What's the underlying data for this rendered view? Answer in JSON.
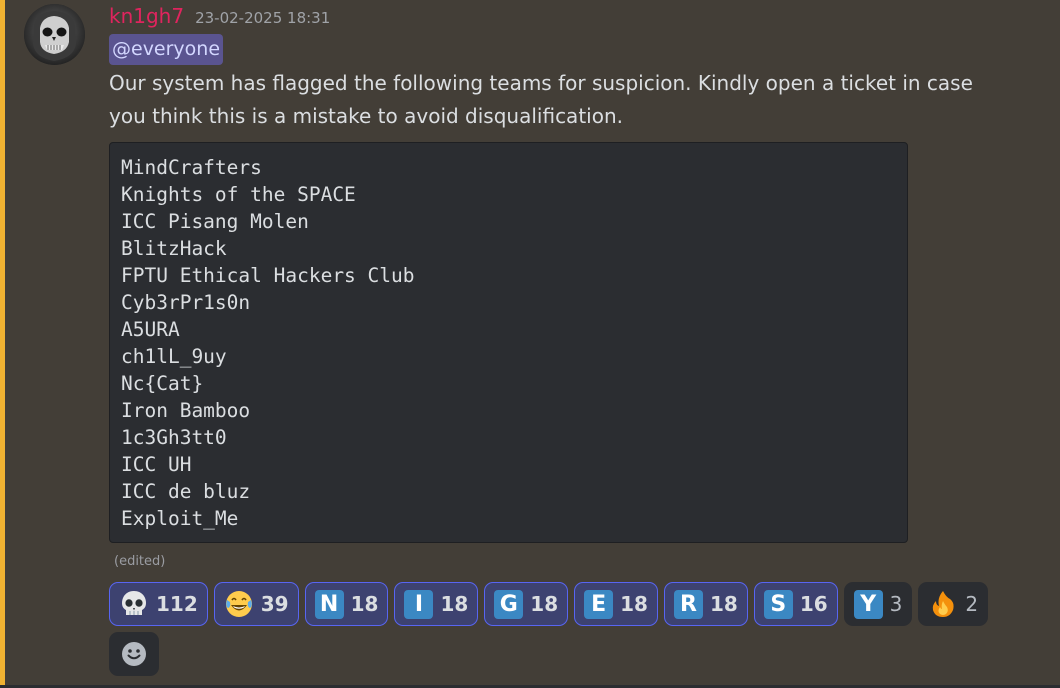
{
  "message": {
    "username": "kn1gh7",
    "timestamp": "23-02-2025 18:31",
    "mention": "@everyone",
    "text": "Our system has flagged the following teams for suspicion. Kindly open a ticket in case you think this is a mistake to avoid disqualification.",
    "code_lines": [
      "MindCrafters",
      "Knights of the SPACE",
      "ICC Pisang Molen",
      "BlitzHack",
      "FPTU Ethical Hackers Club",
      "Cyb3rPr1s0n",
      "A5URA",
      "ch1lL_9uy",
      "Nc{Cat}",
      "Iron Bamboo",
      "1c3Gh3tt0",
      "ICC UH",
      "ICC de bluz",
      "Exploit_Me"
    ],
    "edited_label": "(edited)"
  },
  "reactions": [
    {
      "emoji": "skull-emoji",
      "count": "112",
      "me": true
    },
    {
      "emoji": "joy-emoji",
      "count": "39",
      "me": true
    },
    {
      "emoji": "regional-n",
      "letter": "N",
      "count": "18",
      "me": true
    },
    {
      "emoji": "regional-i",
      "letter": "I",
      "count": "18",
      "me": true
    },
    {
      "emoji": "regional-g",
      "letter": "G",
      "count": "18",
      "me": true
    },
    {
      "emoji": "regional-e",
      "letter": "E",
      "count": "18",
      "me": true
    },
    {
      "emoji": "regional-r",
      "letter": "R",
      "count": "18",
      "me": true
    },
    {
      "emoji": "regional-s",
      "letter": "S",
      "count": "16",
      "me": true
    },
    {
      "emoji": "regional-y",
      "letter": "Y",
      "count": "3",
      "me": false
    },
    {
      "emoji": "fire-emoji",
      "count": "2",
      "me": false
    }
  ],
  "colors": {
    "background": "#433e37",
    "mention_bar": "#f0b232",
    "username": "#e0245e",
    "reaction_active_border": "#5865f2",
    "regional_indicator": "#3b88c3"
  }
}
